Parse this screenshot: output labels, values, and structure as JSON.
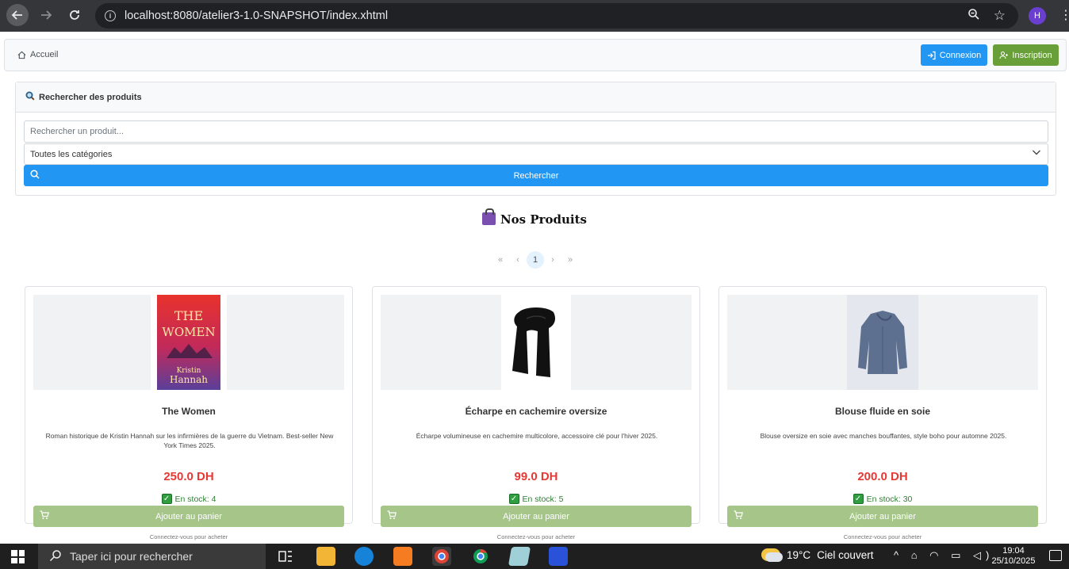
{
  "browser": {
    "url": "localhost:8080/atelier3-1.0-SNAPSHOT/index.xhtml",
    "profile_initial": "H"
  },
  "header": {
    "home_label": "Accueil",
    "login_label": "Connexion",
    "register_label": "Inscription"
  },
  "search": {
    "title": "Rechercher des produits",
    "placeholder": "Rechercher un produit...",
    "category_selected": "Toutes les catégories",
    "button_label": "Rechercher"
  },
  "products_section": {
    "title": "Nos Produits",
    "pager": {
      "first": "«",
      "prev": "‹",
      "current_page": "1",
      "next": "›",
      "last": "»"
    }
  },
  "products": [
    {
      "name": "The Women",
      "description": "Roman historique de Kristin Hannah sur les infirmières de la guerre du Vietnam. Best-seller New York Times 2025.",
      "price": "250.0 DH",
      "stock": "En stock: 4",
      "cart_label": "Ajouter au panier",
      "note": "Connectez-vous pour acheter",
      "cover_title": "THE WOMEN",
      "cover_author_first": "Kristin",
      "cover_author_last": "Hannah"
    },
    {
      "name": "Écharpe en cachemire oversize",
      "description": "Écharpe volumineuse en cachemire multicolore, accessoire clé pour l'hiver 2025.",
      "price": "99.0 DH",
      "stock": "En stock: 5",
      "cart_label": "Ajouter au panier",
      "note": "Connectez-vous pour acheter"
    },
    {
      "name": "Blouse fluide en soie",
      "description": "Blouse oversize en soie avec manches bouffantes, style boho pour automne 2025.",
      "price": "200.0 DH",
      "stock": "En stock: 30",
      "cart_label": "Ajouter au panier",
      "note": "Connectez-vous pour acheter"
    }
  ],
  "taskbar": {
    "search_placeholder": "Taper ici pour rechercher",
    "weather_temp": "19°C",
    "weather_desc": "Ciel couvert",
    "time": "19:04",
    "date": "25/10/2025"
  },
  "colors": {
    "primary": "#2196f3",
    "success": "#689f38",
    "cart_disabled": "#a5c589",
    "price": "#e53935",
    "stock": "#2e7d32"
  }
}
